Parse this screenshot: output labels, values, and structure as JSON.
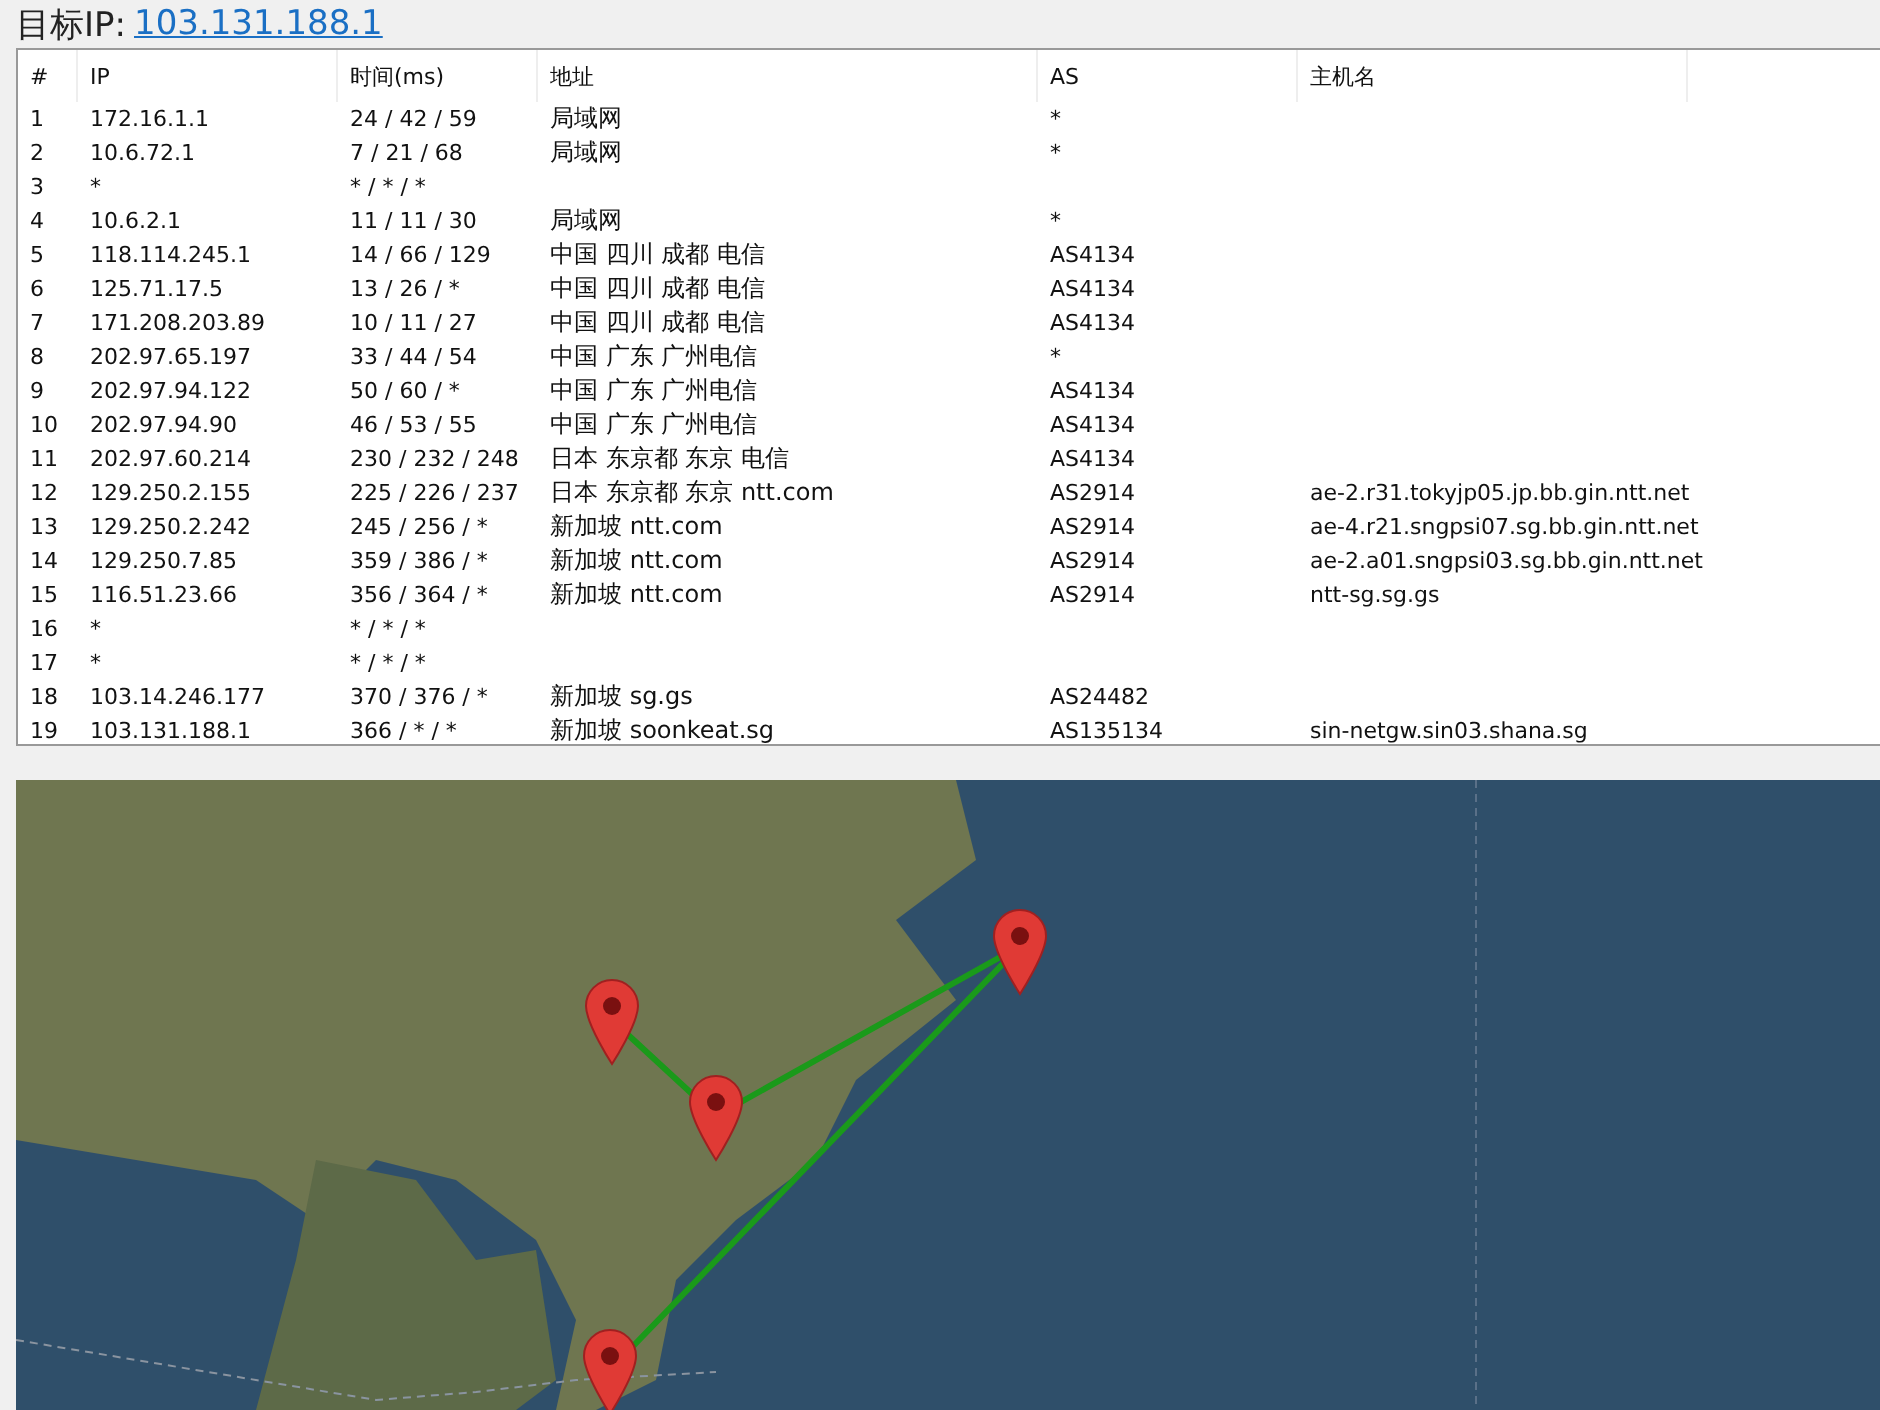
{
  "target": {
    "label": "目标IP:",
    "ip": "103.131.188.1"
  },
  "table": {
    "columns": [
      "#",
      "IP",
      "时间(ms)",
      "地址",
      "AS",
      "主机名"
    ],
    "rows": [
      [
        "1",
        "172.16.1.1",
        "24 / 42 / 59",
        "局域网",
        "*",
        ""
      ],
      [
        "2",
        "10.6.72.1",
        "7 / 21 / 68",
        "局域网",
        "*",
        ""
      ],
      [
        "3",
        "*",
        "* / * / *",
        "",
        "",
        ""
      ],
      [
        "4",
        "10.6.2.1",
        "11 / 11 / 30",
        "局域网",
        "*",
        ""
      ],
      [
        "5",
        "118.114.245.1",
        "14 / 66 / 129",
        "中国 四川 成都 电信",
        "AS4134",
        ""
      ],
      [
        "6",
        "125.71.17.5",
        "13 / 26 / *",
        "中国 四川 成都 电信",
        "AS4134",
        ""
      ],
      [
        "7",
        "171.208.203.89",
        "10 / 11 / 27",
        "中国 四川 成都 电信",
        "AS4134",
        ""
      ],
      [
        "8",
        "202.97.65.197",
        "33 / 44 / 54",
        "中国 广东 广州电信",
        "*",
        ""
      ],
      [
        "9",
        "202.97.94.122",
        "50 / 60 / *",
        "中国 广东 广州电信",
        "AS4134",
        ""
      ],
      [
        "10",
        "202.97.94.90",
        "46 / 53 / 55",
        "中国 广东 广州电信",
        "AS4134",
        ""
      ],
      [
        "11",
        "202.97.60.214",
        "230 / 232 / 248",
        "日本 东京都 东京 电信",
        "AS4134",
        ""
      ],
      [
        "12",
        "129.250.2.155",
        "225 / 226 / 237",
        "日本 东京都 东京 ntt.com",
        "AS2914",
        "ae-2.r31.tokyjp05.jp.bb.gin.ntt.net"
      ],
      [
        "13",
        "129.250.2.242",
        "245 / 256 / *",
        "新加坡 ntt.com",
        "AS2914",
        "ae-4.r21.sngpsi07.sg.bb.gin.ntt.net"
      ],
      [
        "14",
        "129.250.7.85",
        "359 / 386 / *",
        "新加坡 ntt.com",
        "AS2914",
        "ae-2.a01.sngpsi03.sg.bb.gin.ntt.net"
      ],
      [
        "15",
        "116.51.23.66",
        "356 / 364 / *",
        "新加坡 ntt.com",
        "AS2914",
        "ntt-sg.sg.gs"
      ],
      [
        "16",
        "*",
        "* / * / *",
        "",
        "",
        ""
      ],
      [
        "17",
        "*",
        "* / * / *",
        "",
        "",
        ""
      ],
      [
        "18",
        "103.14.246.177",
        "370 / 376 / *",
        "新加坡 sg.gs",
        "AS24482",
        ""
      ],
      [
        "19",
        "103.131.188.1",
        "366 / * / *",
        "新加坡 soonkeat.sg",
        "AS135134",
        "sin-netgw.sin03.shana.sg"
      ]
    ]
  }
}
